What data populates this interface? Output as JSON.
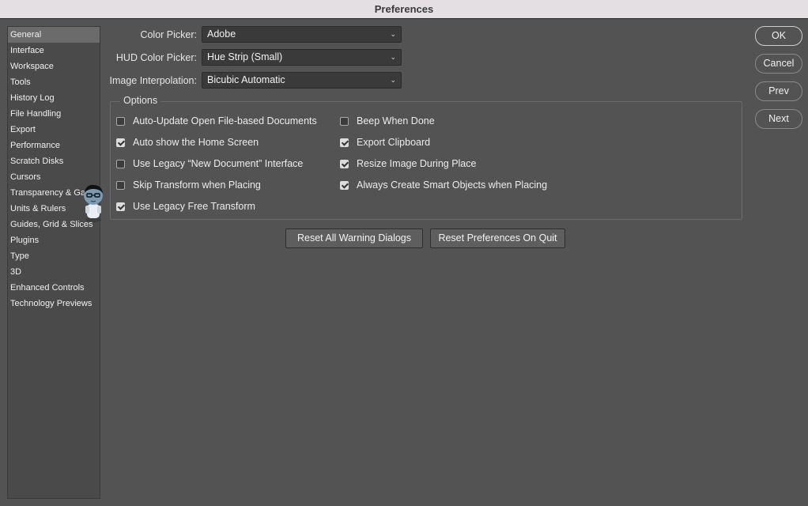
{
  "window": {
    "title": "Preferences"
  },
  "sidebar": {
    "items": [
      {
        "label": "General",
        "selected": true
      },
      {
        "label": "Interface"
      },
      {
        "label": "Workspace"
      },
      {
        "label": "Tools"
      },
      {
        "label": "History Log"
      },
      {
        "label": "File Handling"
      },
      {
        "label": "Export"
      },
      {
        "label": "Performance"
      },
      {
        "label": "Scratch Disks"
      },
      {
        "label": "Cursors"
      },
      {
        "label": "Transparency & Gamut"
      },
      {
        "label": "Units & Rulers"
      },
      {
        "label": "Guides, Grid & Slices"
      },
      {
        "label": "Plugins"
      },
      {
        "label": "Type"
      },
      {
        "label": "3D"
      },
      {
        "label": "Enhanced Controls"
      },
      {
        "label": "Technology Previews"
      }
    ]
  },
  "fields": {
    "color_picker": {
      "label": "Color Picker:",
      "value": "Adobe"
    },
    "hud_color_picker": {
      "label": "HUD Color Picker:",
      "value": "Hue Strip (Small)"
    },
    "image_interpolation": {
      "label": "Image Interpolation:",
      "value": "Bicubic Automatic"
    }
  },
  "options": {
    "legend": "Options",
    "left": [
      {
        "label": "Auto-Update Open File-based Documents",
        "checked": false
      },
      {
        "label": "Auto show the Home Screen",
        "checked": true
      },
      {
        "label": "Use Legacy “New Document” Interface",
        "checked": false
      },
      {
        "label": "Skip Transform when Placing",
        "checked": false
      },
      {
        "label": "Use Legacy Free Transform",
        "checked": true
      }
    ],
    "right": [
      {
        "label": "Beep When Done",
        "checked": false
      },
      {
        "label": "Export Clipboard",
        "checked": true
      },
      {
        "label": "Resize Image During Place",
        "checked": true
      },
      {
        "label": "Always Create Smart Objects when Placing",
        "checked": true
      }
    ]
  },
  "buttons": {
    "reset_warnings": "Reset All Warning Dialogs",
    "reset_prefs": "Reset Preferences On Quit",
    "ok": "OK",
    "cancel": "Cancel",
    "prev": "Prev",
    "next": "Next"
  },
  "icons": {
    "dropdown": "chevron-down-icon",
    "checkbox_checked": "checkmark-icon"
  }
}
